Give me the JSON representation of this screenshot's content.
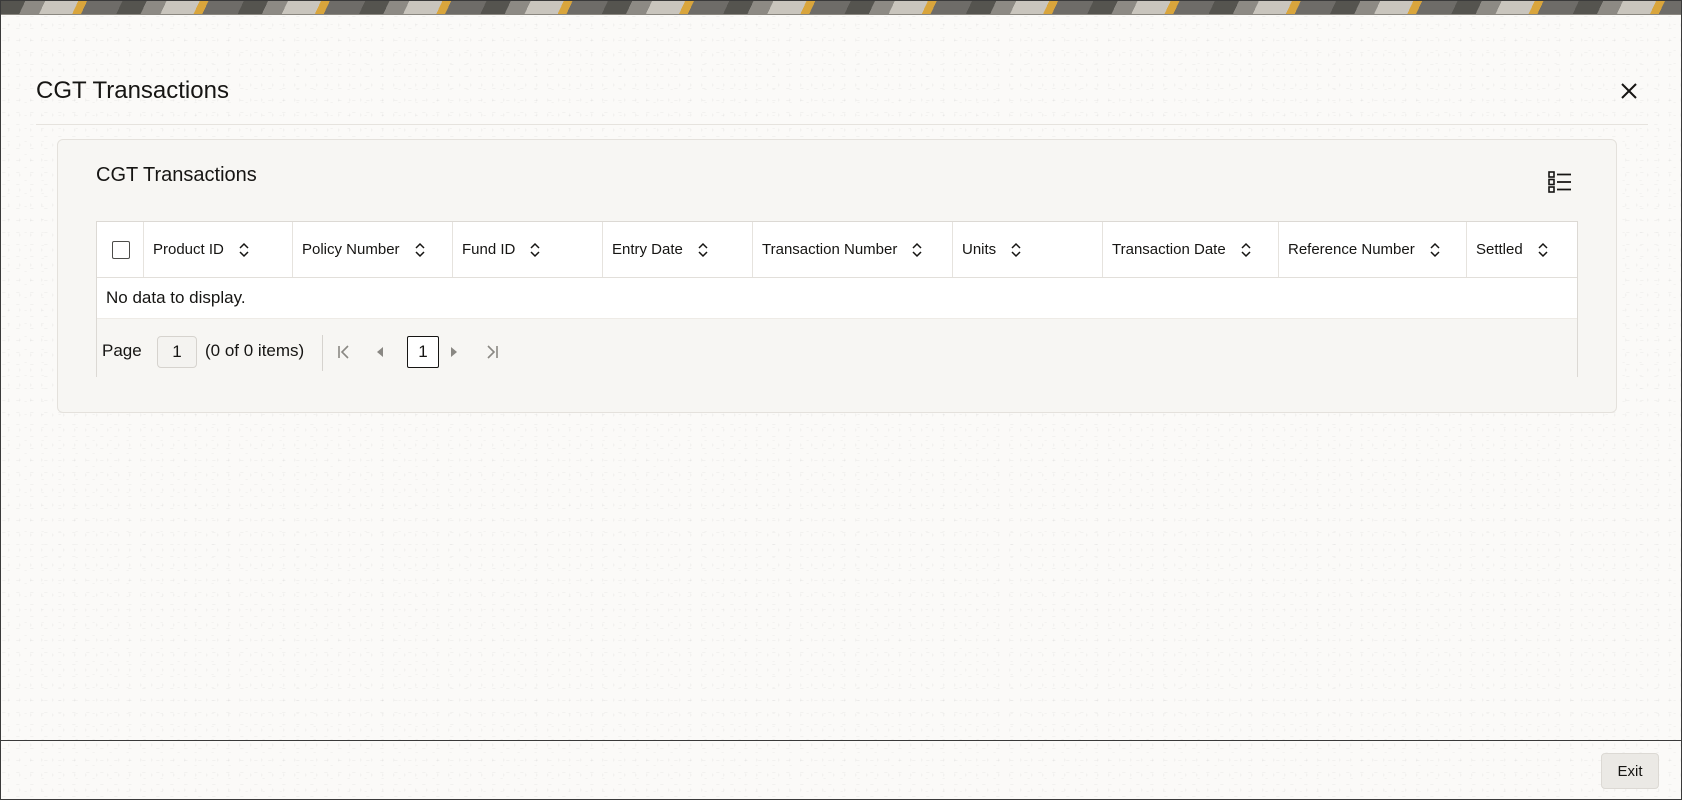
{
  "window": {
    "title": "CGT Transactions"
  },
  "panel": {
    "title": "CGT Transactions"
  },
  "table": {
    "columns": [
      "Product ID",
      "Policy Number",
      "Fund ID",
      "Entry Date",
      "Transaction Number",
      "Units",
      "Transaction Date",
      "Reference Number",
      "Settled"
    ],
    "empty_message": "No data to display."
  },
  "pagination": {
    "page_label": "Page",
    "page_value": "1",
    "count_text": "(0 of 0 items)",
    "current_page": "1"
  },
  "footer": {
    "exit_label": "Exit"
  },
  "icons": {
    "close": "close-icon",
    "column_selector": "list-view-icon",
    "sort": "sort-icon",
    "first_page": "first-page-icon",
    "prev_page": "previous-page-icon",
    "next_page": "next-page-icon",
    "last_page": "last-page-icon"
  }
}
